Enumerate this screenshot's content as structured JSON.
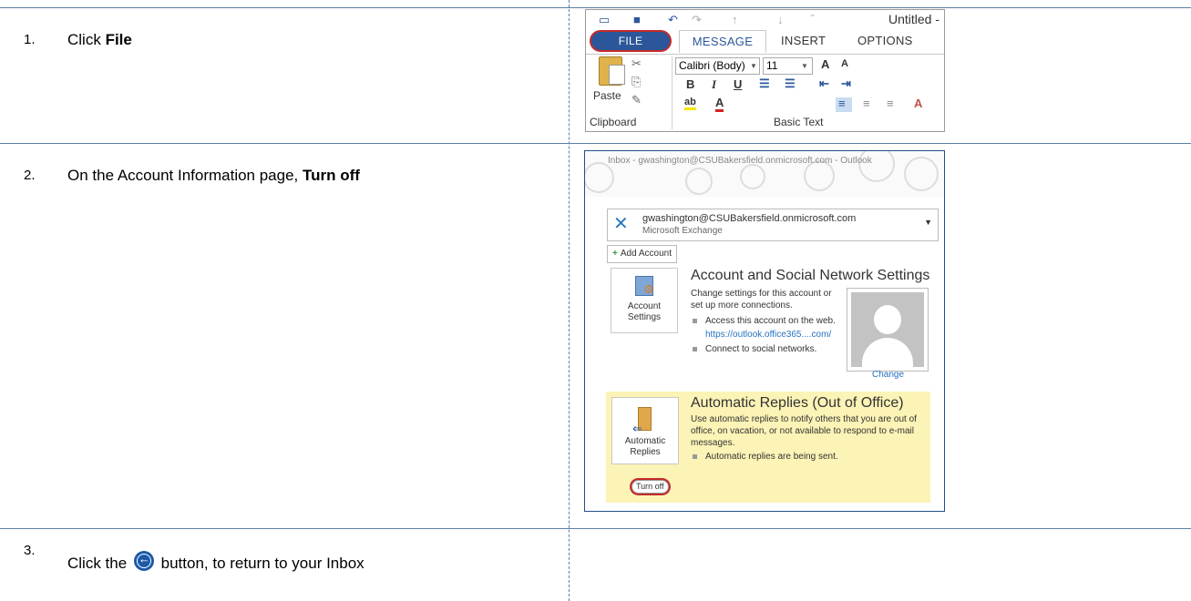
{
  "steps": [
    {
      "number": "1.",
      "prefix": "Click ",
      "bold": "File"
    },
    {
      "number": "2.",
      "prefix": "On the Account Information page, ",
      "bold": "Turn off"
    },
    {
      "number": "3.",
      "prefix": "Click the ",
      "suffix": " button, to return to your Inbox",
      "icon": "back-arrow-icon"
    }
  ],
  "ribbon": {
    "doc_title": "Untitled - Me",
    "tabs": {
      "file": "FILE",
      "message": "MESSAGE",
      "insert": "INSERT",
      "options": "OPTIONS"
    },
    "font_name": "Calibri (Body)",
    "font_size": "11",
    "paste_label": "Paste",
    "clipboard_label": "Clipboard",
    "basic_text_label": "Basic Text",
    "active_tab": "MESSAGE"
  },
  "account": {
    "window_title": "Inbox - gwashington@CSUBakersfield.onmicrosoft.com - Outlook",
    "email": "gwashington@CSUBakersfield.onmicrosoft.com",
    "account_type": "Microsoft Exchange",
    "add_account": "Add Account",
    "settings_button": "Account Settings",
    "settings_title": "Account and Social Network Settings",
    "settings_desc": "Change settings for this account or set up more connections.",
    "access_web": "Access this account on the web.",
    "web_link": "https://outlook.office365....com/",
    "connect_social": "Connect to social networks.",
    "change_photo": "Change",
    "auto_button": "Automatic Replies",
    "auto_title": "Automatic Replies (Out of Office)",
    "auto_desc": "Use automatic replies to notify others that you are out of office, on vacation, or not available to respond to e-mail messages.",
    "auto_status": "Automatic replies are being sent.",
    "turn_off": "Turn off"
  },
  "colors": {
    "accent": "#2b579a",
    "highlight_ring": "#c42a2a",
    "ooo_background": "#fcf3b6"
  }
}
